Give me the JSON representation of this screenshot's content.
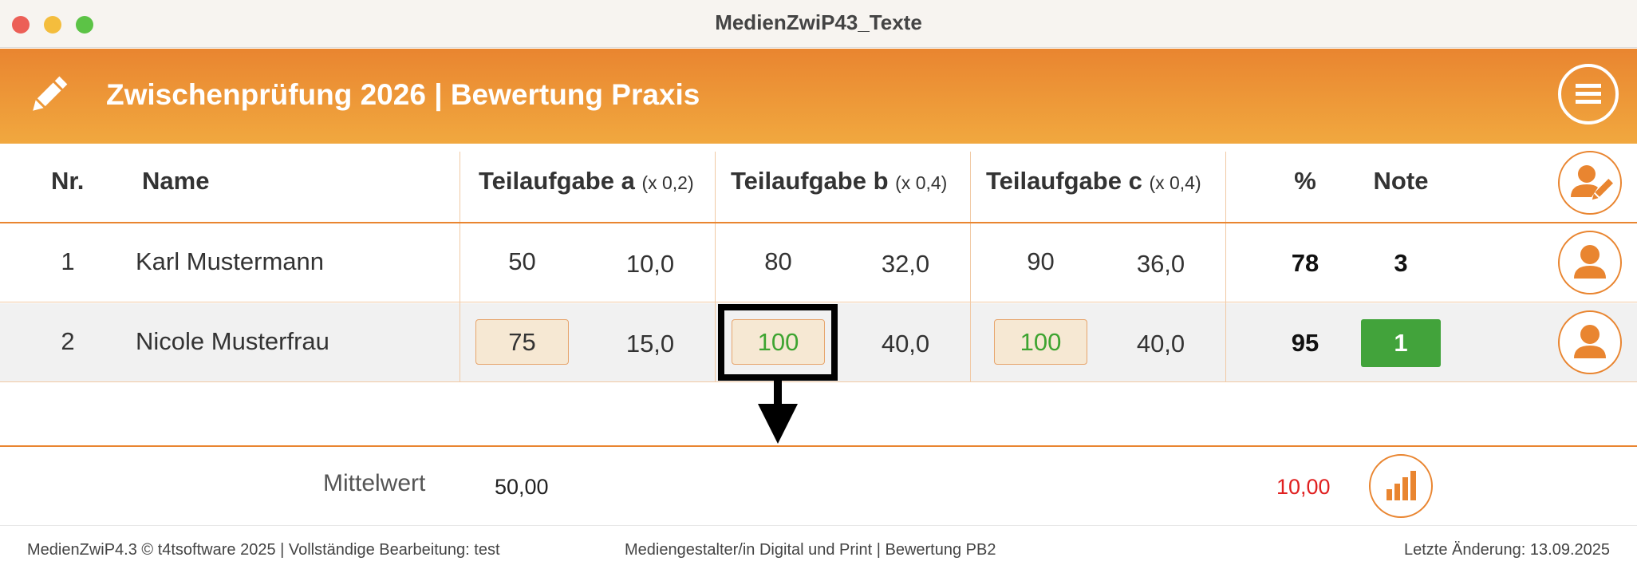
{
  "window": {
    "title": "MedienZwiP43_Texte"
  },
  "header": {
    "title": "Zwischenprüfung 2026 | Bewertung Praxis"
  },
  "columns": {
    "nr": "Nr.",
    "name": "Name",
    "a_label": "Teilaufgabe a",
    "a_factor": "(x 0,2)",
    "b_label": "Teilaufgabe b",
    "b_factor": "(x 0,4)",
    "c_label": "Teilaufgabe c",
    "c_factor": "(x 0,4)",
    "percent": "%",
    "note": "Note"
  },
  "rows": [
    {
      "nr": "1",
      "name": "Karl Mustermann",
      "a_raw": "50",
      "a_weighted": "10,0",
      "b_raw": "80",
      "b_weighted": "32,0",
      "c_raw": "90",
      "c_weighted": "36,0",
      "percent": "78",
      "note": "3"
    },
    {
      "nr": "2",
      "name": "Nicole Musterfrau",
      "a_raw": "75",
      "a_weighted": "15,0",
      "b_raw": "100",
      "b_weighted": "40,0",
      "c_raw": "100",
      "c_weighted": "40,0",
      "percent": "95",
      "note": "1"
    }
  ],
  "summary": {
    "label": "Mittelwert",
    "value": "50,00",
    "red_value": "10,00"
  },
  "footer": {
    "left": "MedienZwiP4.3 © t4tsoftware 2025 | Vollständige Bearbeitung: test",
    "center": "Mediengestalter/in Digital und Print | Bewertung PB2",
    "right": "Letzte Änderung: 13.09.2025"
  },
  "colors": {
    "accent": "#e98530",
    "note_good": "#42a33b",
    "input_bg": "#f6e8d3",
    "red_value": "#e02020"
  },
  "icons": [
    "pencil-icon",
    "menu-icon",
    "user-edit-icon",
    "user-icon",
    "bar-chart-icon"
  ]
}
